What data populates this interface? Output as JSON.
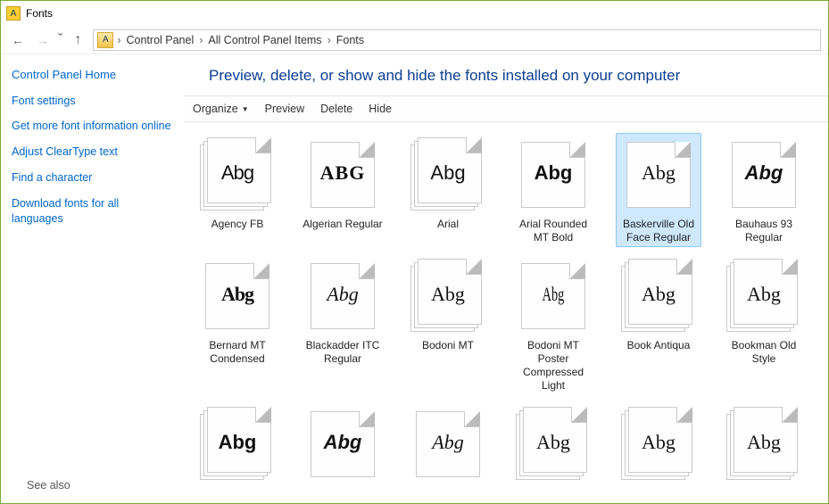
{
  "titlebar": {
    "title": "Fonts"
  },
  "nav": {
    "up_title": "Up"
  },
  "breadcrumb": {
    "items": [
      "Control Panel",
      "All Control Panel Items",
      "Fonts"
    ]
  },
  "sidebar": {
    "home": "Control Panel Home",
    "links": [
      "Font settings",
      "Get more font information online",
      "Adjust ClearType text",
      "Find a character",
      "Download fonts for all languages"
    ],
    "see_also": "See also"
  },
  "heading": "Preview, delete, or show and hide the fonts installed on your computer",
  "toolbar": {
    "organize": "Organize",
    "preview": "Preview",
    "delete": "Delete",
    "hide": "Hide"
  },
  "fonts": {
    "preview_sample": "Abg",
    "preview_sample_upper": "ABG",
    "rows": [
      [
        {
          "name": "Agency FB",
          "stacked": true,
          "pv": "pv-agency",
          "selected": false
        },
        {
          "name": "Algerian Regular",
          "stacked": false,
          "pv": "pv-algerian",
          "upper": true
        },
        {
          "name": "Arial",
          "stacked": true,
          "pv": "pv-arial"
        },
        {
          "name": "Arial Rounded MT Bold",
          "stacked": false,
          "pv": "pv-arialrb"
        },
        {
          "name": "Baskerville Old Face Regular",
          "stacked": false,
          "pv": "pv-baskov",
          "selected": true
        },
        {
          "name": "Bauhaus 93 Regular",
          "stacked": false,
          "pv": "pv-bauhaus"
        }
      ],
      [
        {
          "name": "Bernard MT Condensed",
          "stacked": false,
          "pv": "pv-bernard"
        },
        {
          "name": "Blackadder ITC Regular",
          "stacked": false,
          "pv": "pv-blackad"
        },
        {
          "name": "Bodoni MT",
          "stacked": true,
          "pv": "pv-bodoni"
        },
        {
          "name": "Bodoni MT Poster Compressed Light",
          "stacked": false,
          "pv": "pv-bodonipc"
        },
        {
          "name": "Book Antiqua",
          "stacked": true,
          "pv": "pv-bookant"
        },
        {
          "name": "Bookman Old Style",
          "stacked": true,
          "pv": "pv-bookman"
        }
      ],
      [
        {
          "name": "",
          "stacked": true,
          "pv": "pv-r3a"
        },
        {
          "name": "",
          "stacked": false,
          "pv": "pv-r3b"
        },
        {
          "name": "",
          "stacked": false,
          "pv": "pv-r3c"
        },
        {
          "name": "",
          "stacked": true,
          "pv": "pv-r3d"
        },
        {
          "name": "",
          "stacked": true,
          "pv": "pv-r3e"
        },
        {
          "name": "",
          "stacked": true,
          "pv": "pv-r3f"
        }
      ]
    ]
  }
}
